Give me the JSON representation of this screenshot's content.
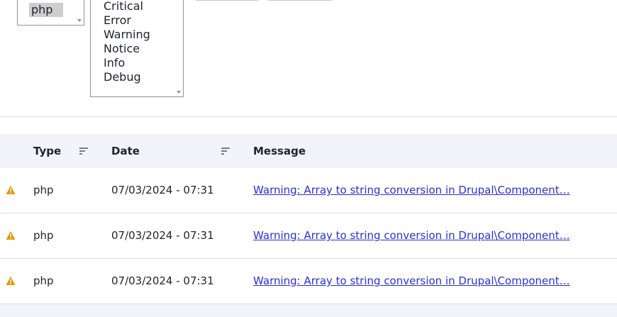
{
  "filters": {
    "type_options": [
      "php"
    ],
    "type_selected": "php",
    "severity_options": [
      "Critical",
      "Error",
      "Warning",
      "Notice",
      "Info",
      "Debug"
    ]
  },
  "table": {
    "headers": {
      "type": "Type",
      "date": "Date",
      "message": "Message"
    },
    "rows": [
      {
        "severity_icon": "warning-icon",
        "type": "php",
        "date": "07/03/2024 - 07:31",
        "message": "Warning: Array to string conversion in Drupal\\Component…"
      },
      {
        "severity_icon": "warning-icon",
        "type": "php",
        "date": "07/03/2024 - 07:31",
        "message": "Warning: Array to string conversion in Drupal\\Component…"
      },
      {
        "severity_icon": "warning-icon",
        "type": "php",
        "date": "07/03/2024 - 07:31",
        "message": "Warning: Array to string conversion in Drupal\\Component…"
      }
    ]
  },
  "colors": {
    "warning": "#e29700",
    "link": "#2b2fd6",
    "header_bg": "#f3f4f9"
  }
}
